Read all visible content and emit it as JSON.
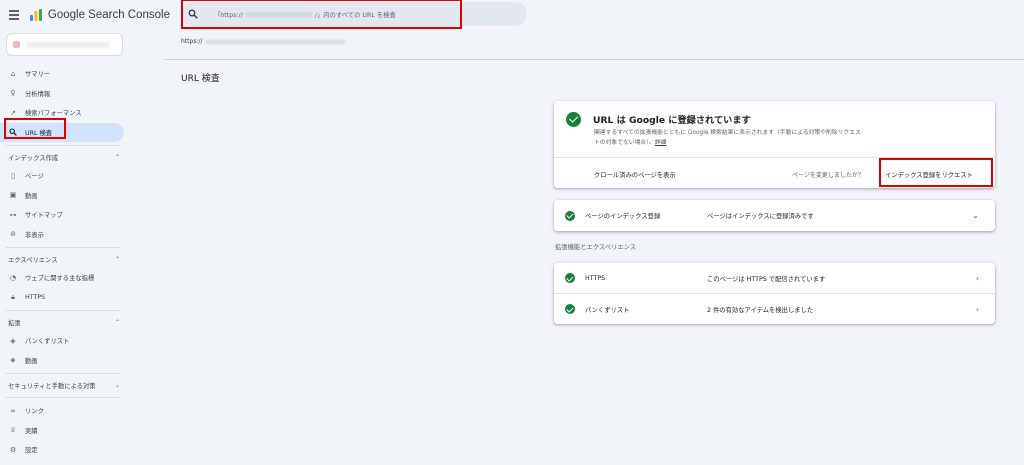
{
  "app": {
    "brand": "Google Search Console"
  },
  "search": {
    "placeholder_prefix": "「https://",
    "placeholder_suffix": "/」内のすべての URL を検査"
  },
  "url_prefix": "https://",
  "page_title": "URL 検査",
  "sidebar": {
    "top_items": [
      {
        "label": "サマリー",
        "icon": "home-icon"
      },
      {
        "label": "分析情報",
        "icon": "insights-icon"
      },
      {
        "label": "検索パフォーマンス",
        "icon": "trending-icon"
      },
      {
        "label": "URL 検査",
        "icon": "search-icon"
      }
    ],
    "sections": [
      {
        "title": "インデックス作成",
        "items": [
          {
            "label": "ページ",
            "icon": "pages-icon"
          },
          {
            "label": "動画",
            "icon": "video-icon"
          },
          {
            "label": "サイトマップ",
            "icon": "sitemap-icon"
          },
          {
            "label": "非表示",
            "icon": "hidden-icon"
          }
        ]
      },
      {
        "title": "エクスペリエンス",
        "items": [
          {
            "label": "ウェブに関する主な指標",
            "icon": "speed-icon"
          },
          {
            "label": "HTTPS",
            "icon": "lock-icon"
          }
        ]
      },
      {
        "title": "拡張",
        "items": [
          {
            "label": "パンくずリスト",
            "icon": "layers-icon"
          },
          {
            "label": "動画",
            "icon": "layers-icon"
          }
        ]
      },
      {
        "title": "セキュリティと手動による対策",
        "items": []
      }
    ],
    "bottom_items": [
      {
        "label": "リンク",
        "icon": "link-icon"
      },
      {
        "label": "実績",
        "icon": "trophy-icon"
      },
      {
        "label": "設定",
        "icon": "settings-icon"
      }
    ]
  },
  "status": {
    "title": "URL は Google に登録されています",
    "description": "関連するすべての拡張機能とともに Google 検索結果に表示されます（手動による対策や削除リクエストの対象でない場合）。",
    "more_link": "詳細",
    "crawled_link": "クロール済みのページを表示",
    "changed_question": "ページを変更しましたか？",
    "request_button": "インデックス登録をリクエスト"
  },
  "index_row": {
    "label": "ページのインデックス登録",
    "value": "ページはインデックスに登録済みです"
  },
  "enhancements": {
    "heading": "拡張機能とエクスペリエンス",
    "rows": [
      {
        "label": "HTTPS",
        "value": "このページは HTTPS で配信されています"
      },
      {
        "label": "パンくずリスト",
        "value": "2 件の有効なアイテムを検出しました"
      }
    ]
  },
  "colors": {
    "success": "#188038",
    "active_nav": "#d3e3fd",
    "highlight": "#e00000"
  }
}
